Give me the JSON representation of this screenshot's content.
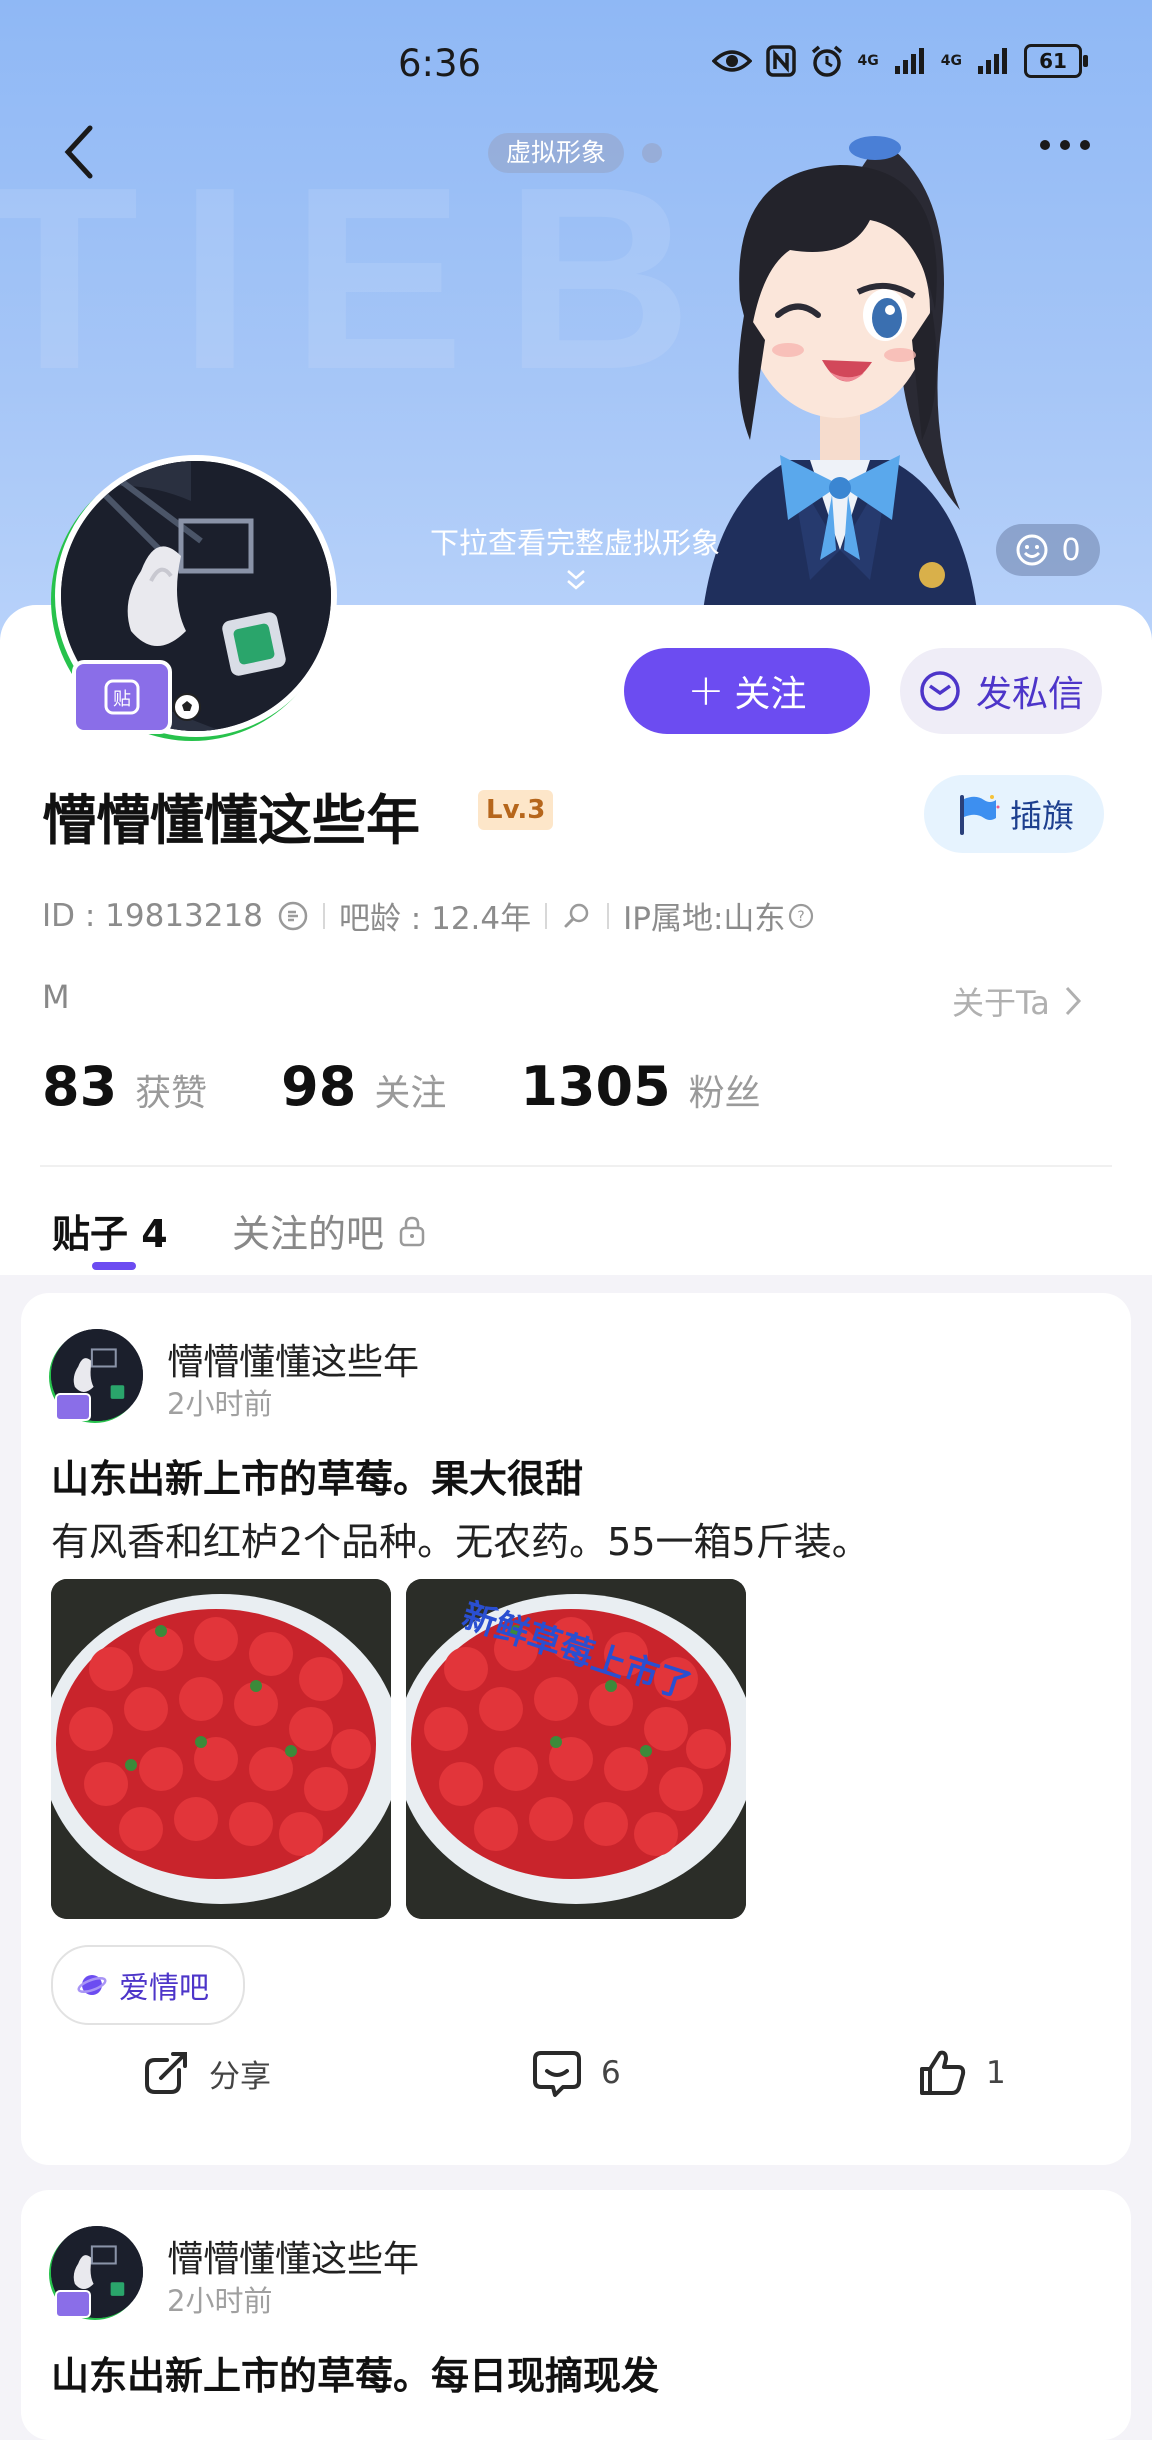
{
  "status_bar": {
    "time": "6:36",
    "network1": "4G",
    "network2": "4G",
    "battery": "61"
  },
  "hero": {
    "avatar_tag": "虚拟形象",
    "pull_hint": "下拉查看完整虚拟形象",
    "emoji_count": "0"
  },
  "profile": {
    "avatar_badge": "贴",
    "follow_label": "关注",
    "message_label": "发私信",
    "username": "懵懵懂懂这些年",
    "level": "Lv.3",
    "flag_label": "插旗",
    "id_text": "ID : 19813218",
    "age_text": "吧龄 : 12.4年",
    "ip_text": "IP属地:山东",
    "bio": "M",
    "about_label": "关于Ta",
    "stats": [
      {
        "num": "83",
        "label": "获赞"
      },
      {
        "num": "98",
        "label": "关注"
      },
      {
        "num": "1305",
        "label": "粉丝"
      }
    ]
  },
  "tabs": {
    "posts": "贴子 4",
    "followed_bars": "关注的吧"
  },
  "posts": [
    {
      "author": "懵懵懂懂这些年",
      "time": "2小时前",
      "title": "山东出新上市的草莓。果大很甜",
      "body": "有风香和红栌2个品种。无农药。55一箱5斤装。",
      "image_overlay": "新鲜草莓上市了",
      "forum": "爱情吧",
      "share_label": "分享",
      "comment_count": "6",
      "like_count": "1"
    },
    {
      "author": "懵懵懂懂这些年",
      "time": "2小时前",
      "title": "山东出新上市的草莓。每日现摘现发"
    }
  ],
  "colors": {
    "accent": "#6c4cf1",
    "hero_bg": "#8fb8f5",
    "level_bg": "#fde6c9"
  }
}
